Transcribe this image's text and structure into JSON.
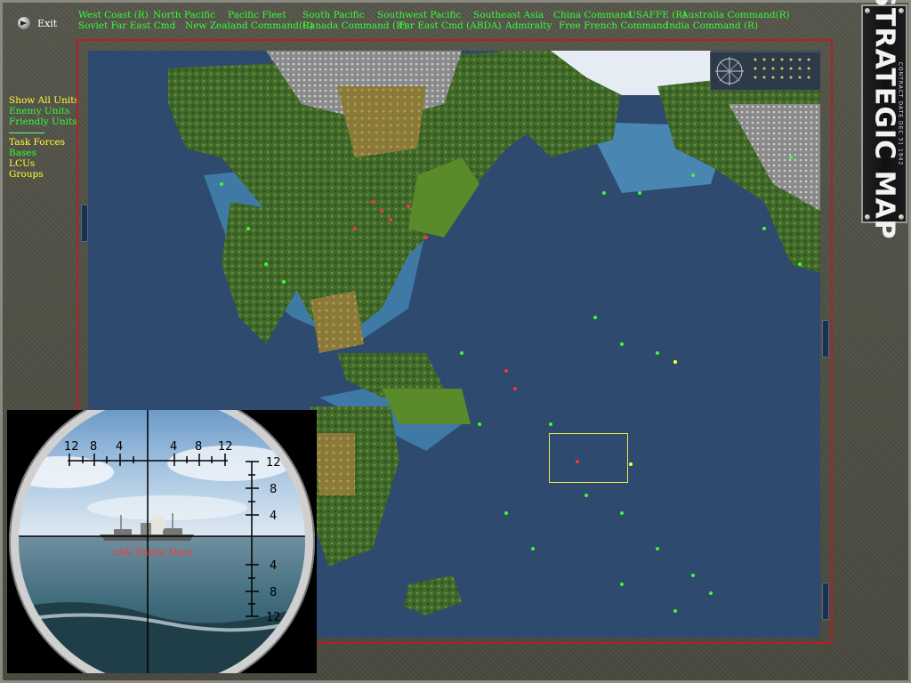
{
  "exit_label": "Exit",
  "commands_row1": [
    "West Coast (R)",
    "North Pacific",
    "Pacific Fleet",
    "South Pacific",
    "Southwest Pacific",
    "Southeast Asia",
    "China Command",
    "USAFFE (R)",
    "Australia Command(R)"
  ],
  "commands_row2": [
    "Soviet Far East Cmd",
    "New Zealand Command(R)",
    "Canada Command (R)",
    "Far East Cmd (ABDA)",
    "Admiralty",
    "Free French Command",
    "India Command (R)"
  ],
  "filters": {
    "show_all": "Show All Units",
    "enemy": "Enemy Units",
    "friendly": "Friendly Units"
  },
  "layers": {
    "task_forces": "Task Forces",
    "bases": "Bases",
    "lcus": "LCUs",
    "groups": "Groups"
  },
  "title": {
    "main": "STRATEGIC MAP",
    "sub": "CONTRACT DATE DEC 31 1942"
  },
  "periscope": {
    "target": "xAK Tihuku Maru",
    "h_ticks": [
      "12",
      "8",
      "4",
      "4",
      "8",
      "12"
    ],
    "v_ticks": [
      "12",
      "8",
      "4",
      "4",
      "8",
      "12"
    ]
  },
  "colors": {
    "command_text": "#33ff33",
    "filter_text": "#ffff33",
    "ocean": "#2e4a6e",
    "map_border": "#b22222"
  }
}
